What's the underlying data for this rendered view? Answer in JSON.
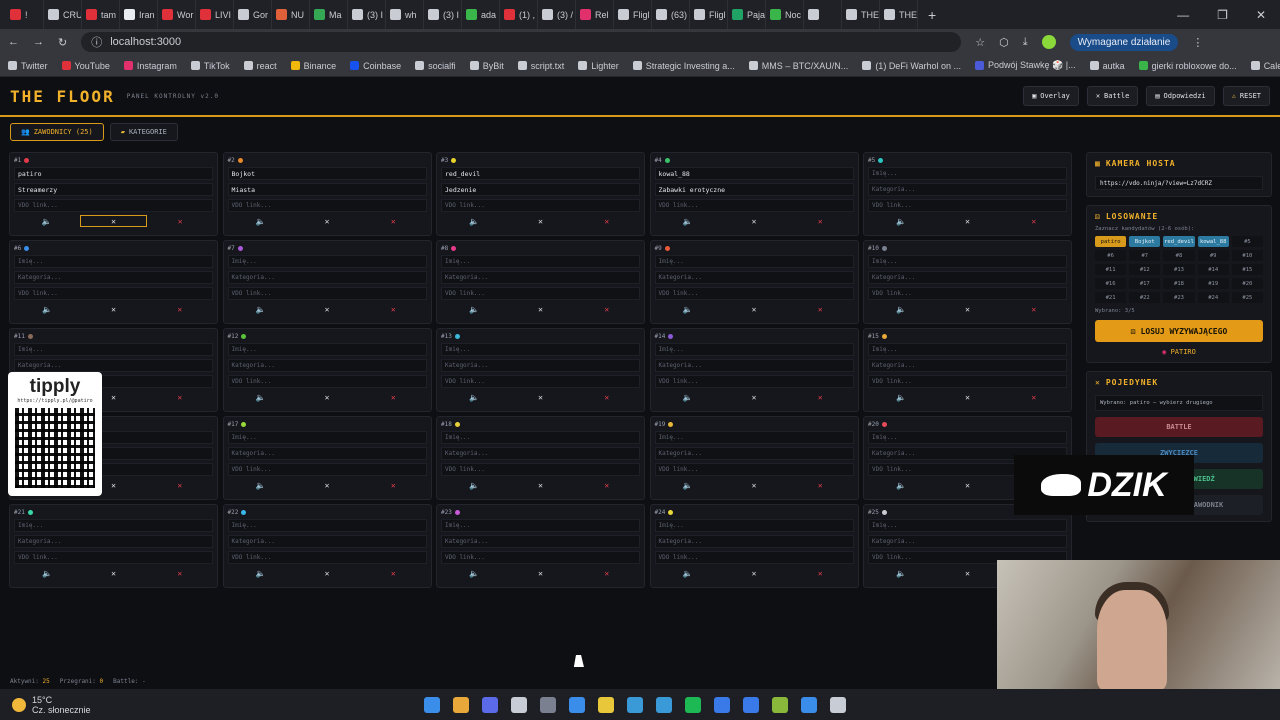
{
  "browser": {
    "tabs": [
      {
        "label": "!",
        "color": "#e0303a"
      },
      {
        "label": "CRU",
        "color": "#c9ccd3"
      },
      {
        "label": "tam",
        "color": "#e0303a"
      },
      {
        "label": "Iran",
        "color": "#e9ecf0"
      },
      {
        "label": "Wor",
        "color": "#e0303a"
      },
      {
        "label": "LIVI",
        "color": "#e0303a"
      },
      {
        "label": "Gor",
        "color": "#c9ccd3"
      },
      {
        "label": "NU",
        "color": "#e0603a"
      },
      {
        "label": "Ma",
        "color": "#35a853"
      },
      {
        "label": "(3) I",
        "color": "#c9ccd3"
      },
      {
        "label": "wh",
        "color": "#c9ccd3"
      },
      {
        "label": "(3) I",
        "color": "#c9ccd3"
      },
      {
        "label": "ada",
        "color": "#3ab54a"
      },
      {
        "label": "(1) ,",
        "color": "#e0303a"
      },
      {
        "label": "(3) /",
        "color": "#c9ccd3"
      },
      {
        "label": "Rel",
        "color": "#e1306c"
      },
      {
        "label": "Fligl",
        "color": "#c9ccd3"
      },
      {
        "label": "(63)",
        "color": "#c9ccd3"
      },
      {
        "label": "Fligl",
        "color": "#c9ccd3"
      },
      {
        "label": "Paja",
        "color": "#21a366"
      },
      {
        "label": "Noc",
        "color": "#3ab54a"
      },
      {
        "label": "",
        "color": "#c9ccd3"
      },
      {
        "label": "THE",
        "color": "#c9ccd3"
      },
      {
        "label": "THE",
        "color": "#c9ccd3"
      }
    ],
    "new_tab": "+",
    "window_controls": [
      "—",
      "❐",
      "✕"
    ],
    "url": "localhost:3000",
    "action_label": "Wymagane działanie",
    "bookmarks": [
      {
        "label": "Twitter",
        "color": "#c9ccd3"
      },
      {
        "label": "YouTube",
        "color": "#e0303a"
      },
      {
        "label": "Instagram",
        "color": "#e1306c"
      },
      {
        "label": "TikTok",
        "color": "#c9ccd3"
      },
      {
        "label": "react",
        "color": "#c9ccd3"
      },
      {
        "label": "Binance",
        "color": "#f0b90b"
      },
      {
        "label": "Coinbase",
        "color": "#1652f0"
      },
      {
        "label": "socialfi",
        "color": "#c9ccd3"
      },
      {
        "label": "ByBit",
        "color": "#c9ccd3"
      },
      {
        "label": "script.txt",
        "color": "#c9ccd3"
      },
      {
        "label": "Lighter",
        "color": "#c9ccd3"
      },
      {
        "label": "Strategic Investing a...",
        "color": "#c9ccd3"
      },
      {
        "label": "MMS – BTC/XAU/N...",
        "color": "#c9ccd3"
      },
      {
        "label": "(1) DeFi Warhol on ...",
        "color": "#c9ccd3"
      },
      {
        "label": "Podwój Stawkę 🎲 |...",
        "color": "#4a5ad8"
      },
      {
        "label": "autka",
        "color": "#c9ccd3"
      },
      {
        "label": "gierki robloxowe do...",
        "color": "#3ab54a"
      },
      {
        "label": "Calendar | Forex Fac...",
        "color": "#c9ccd3"
      }
    ]
  },
  "app": {
    "logo": "THE FLOOR",
    "subtitle": "PANEL KONTROLNY v2.0",
    "header_buttons": [
      "Overlay",
      "Battle",
      "Odpowiedzi",
      "RESET"
    ],
    "subtabs": [
      "ZAWODNICY (25)",
      "KATEGORIE"
    ],
    "placeholders": {
      "name": "Imię...",
      "category": "Kategoria...",
      "vdo": "VDO link..."
    },
    "contestants": [
      {
        "num": "#1",
        "color": "#e23a4b",
        "name": "patiro",
        "category": "Streamerzy"
      },
      {
        "num": "#2",
        "color": "#e8892a",
        "name": "Bojkot",
        "category": "Miasta"
      },
      {
        "num": "#3",
        "color": "#e6d22a",
        "name": "red_devil",
        "category": "Jedzenie"
      },
      {
        "num": "#4",
        "color": "#3ac26a",
        "name": "kowal_88",
        "category": "Zabawki erotyczne"
      },
      {
        "num": "#5",
        "color": "#2ac6c0",
        "name": "",
        "category": ""
      },
      {
        "num": "#6",
        "color": "#3a8de8",
        "name": "",
        "category": ""
      },
      {
        "num": "#7",
        "color": "#a95ad8",
        "name": "",
        "category": ""
      },
      {
        "num": "#8",
        "color": "#e83a8a",
        "name": "",
        "category": ""
      },
      {
        "num": "#9",
        "color": "#e85a3a",
        "name": "",
        "category": ""
      },
      {
        "num": "#10",
        "color": "#7a8090",
        "name": "",
        "category": ""
      },
      {
        "num": "#11",
        "color": "#8a6a5a",
        "name": "",
        "category": ""
      },
      {
        "num": "#12",
        "color": "#5ac23a",
        "name": "",
        "category": ""
      },
      {
        "num": "#13",
        "color": "#3ab8d8",
        "name": "",
        "category": ""
      },
      {
        "num": "#14",
        "color": "#8a5ad8",
        "name": "",
        "category": ""
      },
      {
        "num": "#15",
        "color": "#e8a83a",
        "name": "",
        "category": ""
      },
      {
        "num": "#16",
        "color": "#3a8de8",
        "name": "",
        "category": ""
      },
      {
        "num": "#17",
        "color": "#9ad83a",
        "name": "",
        "category": ""
      },
      {
        "num": "#18",
        "color": "#e8d03a",
        "name": "",
        "category": ""
      },
      {
        "num": "#19",
        "color": "#e8b83a",
        "name": "",
        "category": ""
      },
      {
        "num": "#20",
        "color": "#e84a5a",
        "name": "",
        "category": ""
      },
      {
        "num": "#21",
        "color": "#3ad8a8",
        "name": "",
        "category": ""
      },
      {
        "num": "#22",
        "color": "#3ab8e8",
        "name": "",
        "category": ""
      },
      {
        "num": "#23",
        "color": "#c85ad8",
        "name": "",
        "category": ""
      },
      {
        "num": "#24",
        "color": "#e8d83a",
        "name": "",
        "category": ""
      },
      {
        "num": "#25",
        "color": "#c8ccd4",
        "name": "",
        "category": ""
      }
    ],
    "camera": {
      "title": "KAMERA HOSTA",
      "url": "https://vdo.ninja/?view=Lz7dCRZ"
    },
    "draw": {
      "title": "LOSOWANIE",
      "hint": "Zaznacz kandydatów (2-6 osób):",
      "picks": [
        "patiro",
        "Bojkot",
        "red_devil",
        "kowal_88",
        "#5",
        "#6",
        "#7",
        "#8",
        "#9",
        "#10",
        "#11",
        "#12",
        "#13",
        "#14",
        "#15",
        "#16",
        "#17",
        "#18",
        "#19",
        "#20",
        "#21",
        "#22",
        "#23",
        "#24",
        "#25"
      ],
      "selected_count": "Wybrano: 3/5",
      "button": "LOSUJ WYZYWAJĄCEGO",
      "result": "PATIRO"
    },
    "duel": {
      "title": "POJEDYNEK",
      "message": "Wybrano: patiro — wybierz drugiego",
      "buttons": [
        "BATTLE",
        "ZWYCIĘZCE",
        "POKAŻ ODPOWIEDŹ",
        "PASS — DRUGI ZAWODNIK"
      ]
    },
    "status": {
      "active_label": "Aktywni:",
      "active": "25",
      "lost_label": "Przegrani:",
      "lost": "0",
      "battle_label": "Battle:",
      "battle": "-"
    }
  },
  "overlays": {
    "tipply": {
      "title": "tipply",
      "url": "https://tipply.pl/@patiro"
    },
    "dzik": "DZIK"
  },
  "taskbar": {
    "temp": "15°C",
    "weather": "Cz. słonecznie",
    "apps": [
      "#3a8de8",
      "#e8a83a",
      "#5a6ae8",
      "#c8ccd4",
      "#7a8090",
      "#3a8de8",
      "#e8c83a",
      "#3a9ad8",
      "#3a9ad8",
      "#1db954",
      "#3a7ae8",
      "#3a7ae8",
      "#8ab83a",
      "#3a8de8",
      "#c8ccd4"
    ]
  }
}
